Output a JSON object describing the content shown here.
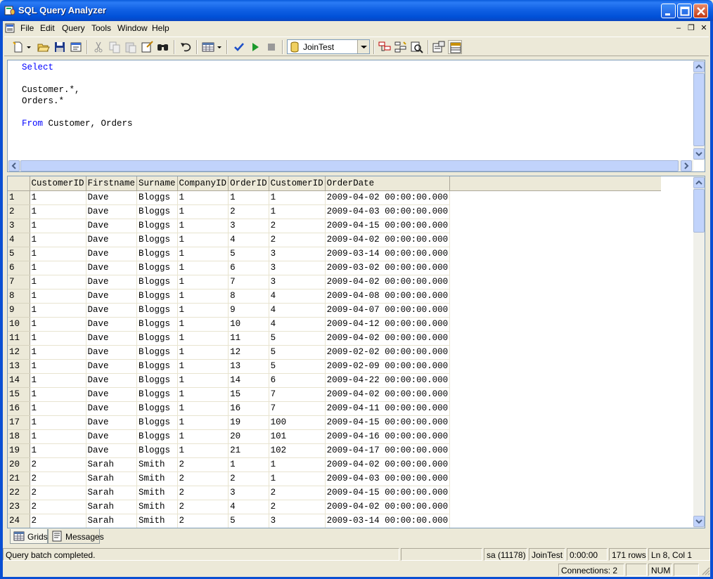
{
  "window": {
    "title": "SQL Query Analyzer"
  },
  "menu": [
    "File",
    "Edit",
    "Query",
    "Tools",
    "Window",
    "Help"
  ],
  "toolbar": {
    "database": "JoinTest",
    "icons": [
      "new-query-icon",
      "open-icon",
      "save-icon",
      "load-script-icon",
      "cut-icon",
      "copy-icon",
      "paste-icon",
      "clear-icon",
      "find-icon",
      "undo-icon",
      "results-mode-icon",
      "parse-icon",
      "execute-icon",
      "stop-icon",
      "database-icon",
      "object-browser-icon",
      "object-search-icon",
      "execution-plan-icon",
      "properties-icon",
      "grid-pane-icon"
    ]
  },
  "editor": {
    "lines": [
      [
        {
          "t": "Select",
          "kw": true
        }
      ],
      [],
      [
        {
          "t": "Customer.*,",
          "kw": false
        }
      ],
      [
        {
          "t": "Orders.*",
          "kw": false
        }
      ],
      [],
      [
        {
          "t": "From",
          "kw": true
        },
        {
          "t": " Customer, Orders",
          "kw": false
        }
      ]
    ]
  },
  "grid": {
    "columns": [
      "CustomerID",
      "Firstname",
      "Surname",
      "CompanyID",
      "OrderID",
      "CustomerID",
      "OrderDate"
    ],
    "rows": [
      [
        "1",
        "1",
        "Dave",
        "Bloggs",
        "1",
        "1",
        "1",
        "2009-04-02 00:00:00.000"
      ],
      [
        "2",
        "1",
        "Dave",
        "Bloggs",
        "1",
        "2",
        "1",
        "2009-04-03 00:00:00.000"
      ],
      [
        "3",
        "1",
        "Dave",
        "Bloggs",
        "1",
        "3",
        "2",
        "2009-04-15 00:00:00.000"
      ],
      [
        "4",
        "1",
        "Dave",
        "Bloggs",
        "1",
        "4",
        "2",
        "2009-04-02 00:00:00.000"
      ],
      [
        "5",
        "1",
        "Dave",
        "Bloggs",
        "1",
        "5",
        "3",
        "2009-03-14 00:00:00.000"
      ],
      [
        "6",
        "1",
        "Dave",
        "Bloggs",
        "1",
        "6",
        "3",
        "2009-03-02 00:00:00.000"
      ],
      [
        "7",
        "1",
        "Dave",
        "Bloggs",
        "1",
        "7",
        "3",
        "2009-04-02 00:00:00.000"
      ],
      [
        "8",
        "1",
        "Dave",
        "Bloggs",
        "1",
        "8",
        "4",
        "2009-04-08 00:00:00.000"
      ],
      [
        "9",
        "1",
        "Dave",
        "Bloggs",
        "1",
        "9",
        "4",
        "2009-04-07 00:00:00.000"
      ],
      [
        "10",
        "1",
        "Dave",
        "Bloggs",
        "1",
        "10",
        "4",
        "2009-04-12 00:00:00.000"
      ],
      [
        "11",
        "1",
        "Dave",
        "Bloggs",
        "1",
        "11",
        "5",
        "2009-04-02 00:00:00.000"
      ],
      [
        "12",
        "1",
        "Dave",
        "Bloggs",
        "1",
        "12",
        "5",
        "2009-02-02 00:00:00.000"
      ],
      [
        "13",
        "1",
        "Dave",
        "Bloggs",
        "1",
        "13",
        "5",
        "2009-02-09 00:00:00.000"
      ],
      [
        "14",
        "1",
        "Dave",
        "Bloggs",
        "1",
        "14",
        "6",
        "2009-04-22 00:00:00.000"
      ],
      [
        "15",
        "1",
        "Dave",
        "Bloggs",
        "1",
        "15",
        "7",
        "2009-04-02 00:00:00.000"
      ],
      [
        "16",
        "1",
        "Dave",
        "Bloggs",
        "1",
        "16",
        "7",
        "2009-04-11 00:00:00.000"
      ],
      [
        "17",
        "1",
        "Dave",
        "Bloggs",
        "1",
        "19",
        "100",
        "2009-04-15 00:00:00.000"
      ],
      [
        "18",
        "1",
        "Dave",
        "Bloggs",
        "1",
        "20",
        "101",
        "2009-04-16 00:00:00.000"
      ],
      [
        "19",
        "1",
        "Dave",
        "Bloggs",
        "1",
        "21",
        "102",
        "2009-04-17 00:00:00.000"
      ],
      [
        "20",
        "2",
        "Sarah",
        "Smith",
        "2",
        "1",
        "1",
        "2009-04-02 00:00:00.000"
      ],
      [
        "21",
        "2",
        "Sarah",
        "Smith",
        "2",
        "2",
        "1",
        "2009-04-03 00:00:00.000"
      ],
      [
        "22",
        "2",
        "Sarah",
        "Smith",
        "2",
        "3",
        "2",
        "2009-04-15 00:00:00.000"
      ],
      [
        "23",
        "2",
        "Sarah",
        "Smith",
        "2",
        "4",
        "2",
        "2009-04-02 00:00:00.000"
      ],
      [
        "24",
        "2",
        "Sarah",
        "Smith",
        "2",
        "5",
        "3",
        "2009-03-14 00:00:00.000"
      ]
    ]
  },
  "tabs": [
    {
      "label": "Grids",
      "icon": "grid-icon",
      "active": true
    },
    {
      "label": "Messages",
      "icon": "messages-icon",
      "active": false
    }
  ],
  "status": {
    "message": "Query batch completed.",
    "user": "sa (11178)",
    "database": "JoinTest",
    "elapsed": "0:00:00",
    "rows": "171 rows",
    "position": "Ln 8, Col 1",
    "connections": "Connections: 2",
    "num": "NUM"
  },
  "colors": {
    "title_bar": "#0A5CDB",
    "keyword": "#0000FF",
    "chrome": "#ECE9D8"
  }
}
